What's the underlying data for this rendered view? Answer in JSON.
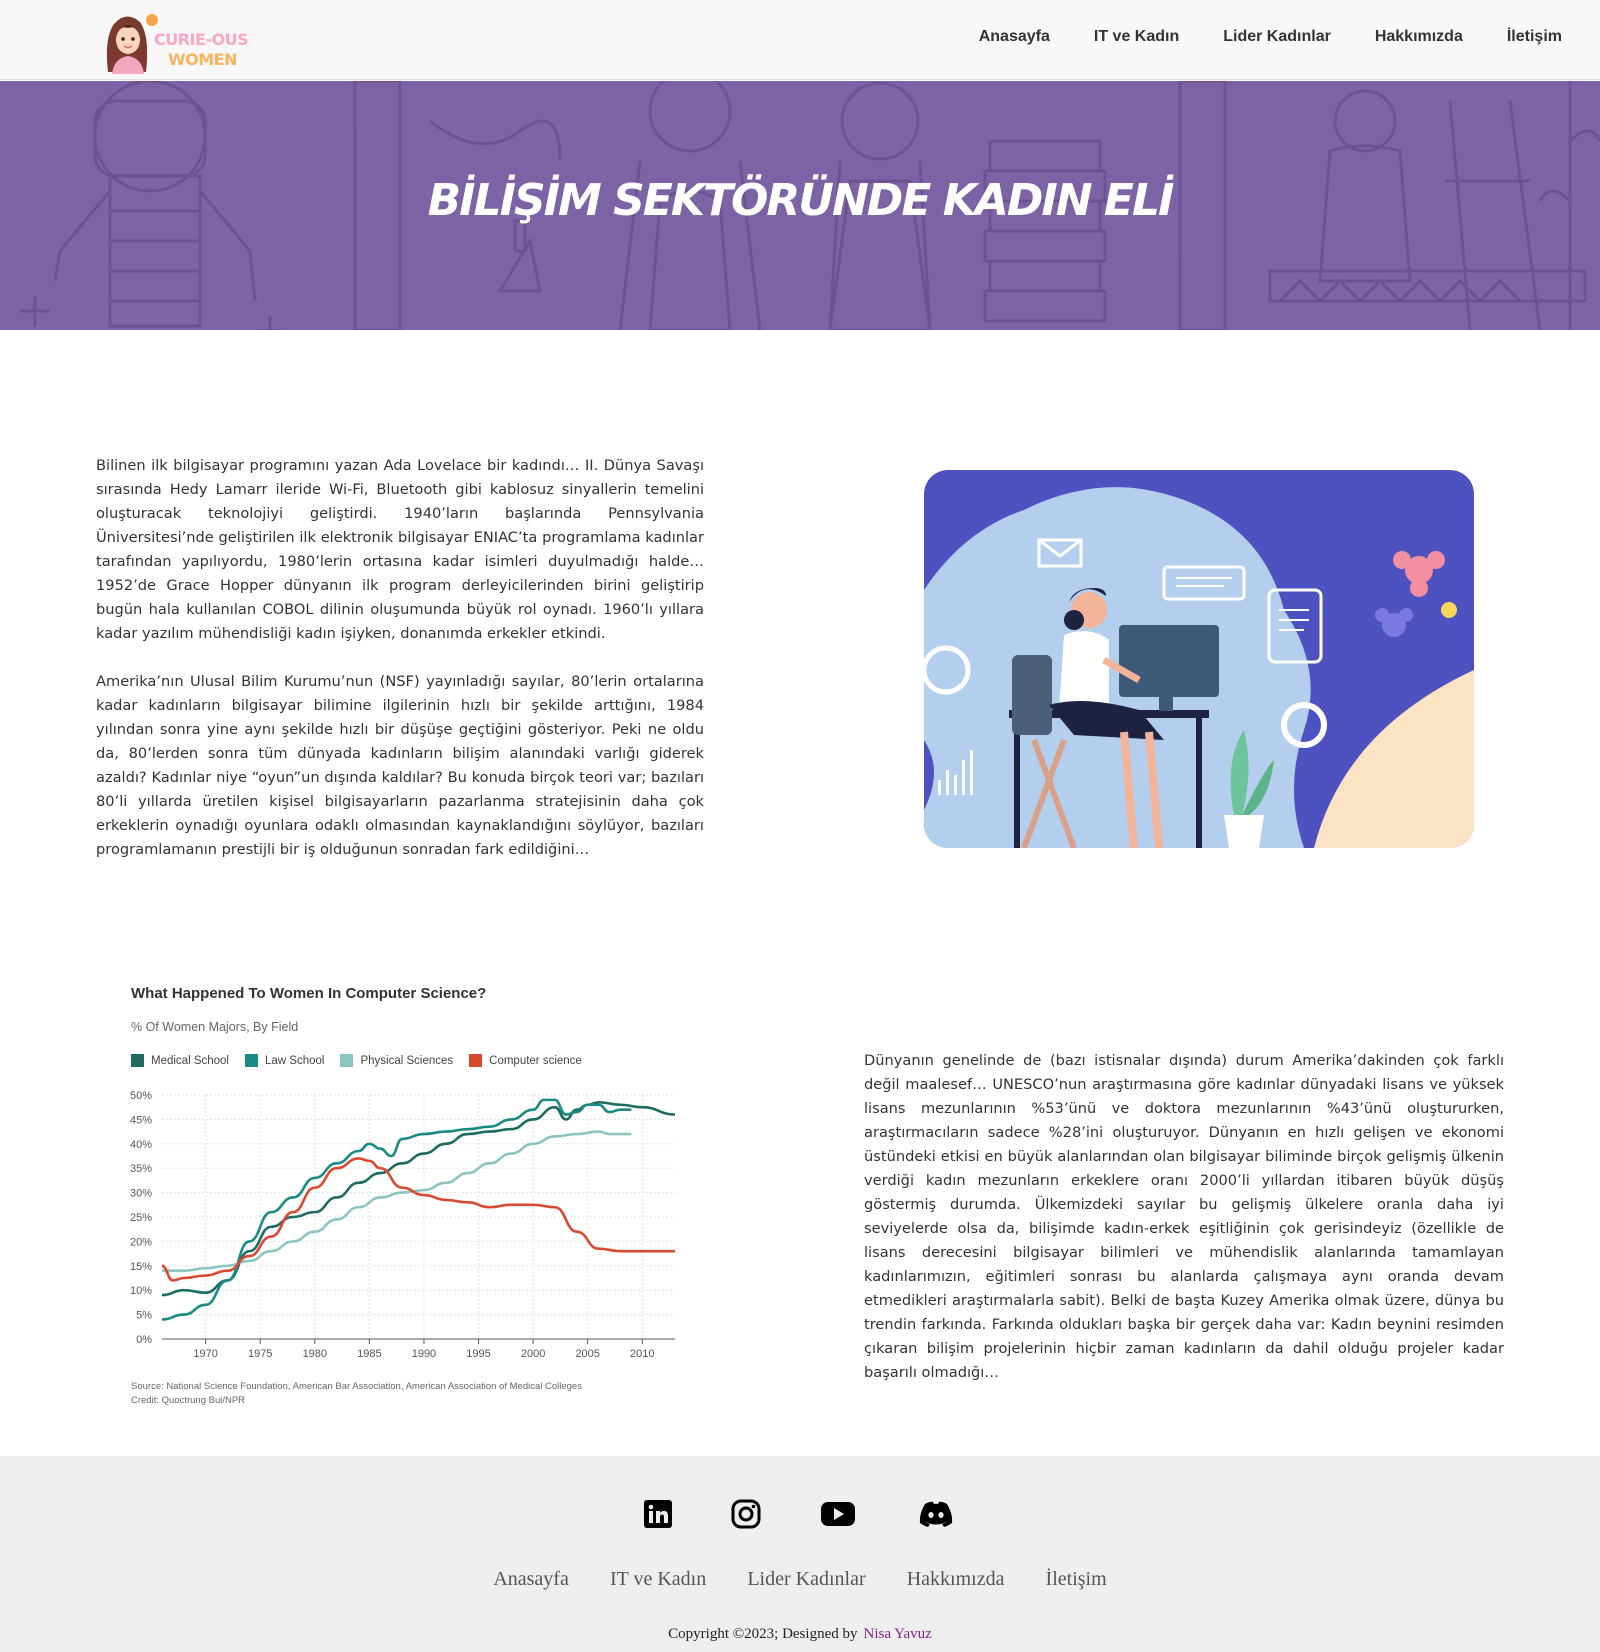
{
  "nav": {
    "logo_line1": "CURIE-OUS",
    "logo_line2": "WOMEN",
    "links": [
      "Anasayfa",
      "IT ve Kadın",
      "Lider Kadınlar",
      "Hakkımızda",
      "İletişim"
    ]
  },
  "hero": {
    "title": "BİLİŞİM SEKTÖRÜNDE KADIN ELİ",
    "bg_color": "#7c63a6"
  },
  "content": {
    "paragraph1": "Bilinen ilk bilgisayar programını yazan Ada Lovelace bir kadındı… II. Dünya Savaşı sırasında Hedy Lamarr ileride Wi-Fi, Bluetooth gibi kablosuz sinyallerin temelini oluşturacak teknolojiyi geliştirdi. 1940’ların başlarında Pennsylvania Üniversitesi’nde geliştirilen ilk elektronik bilgisayar ENIAC’ta programlama kadınlar tarafından yapılıyordu, 1980’lerin ortasına kadar isimleri duyulmadığı halde… 1952’de Grace Hopper dünyanın ilk program derleyicilerinden birini geliştirip bugün hala kullanılan COBOL dilinin oluşumunda büyük rol oynadı. 1960’lı yıllara kadar yazılım mühendisliği kadın işiyken, donanımda erkekler etkindi.",
    "paragraph2": "Amerika’nın Ulusal Bilim Kurumu’nun (NSF) yayınladığı sayılar, 80’lerin ortalarına kadar kadınların bilgisayar bilimine ilgilerinin hızlı bir şekilde arttığını, 1984 yılından sonra yine aynı şekilde hızlı bir düşüşe geçtiğini gösteriyor. Peki ne oldu da, 80’lerden sonra tüm dünyada kadınların bilişim alanındaki varlığı giderek azaldı? Kadınlar niye “oyun”un dışında kaldılar? Bu konuda birçok teori var; bazıları 80’li yıllarda üretilen kişisel bilgisayarların pazarlanma stratejisinin daha çok erkeklerin oynadığı oyunlara odaklı olmasından kaynaklandığını söylüyor, bazıları programlamanın prestijli bir iş olduğunun sonradan fark edildiğini…",
    "paragraph3": "Dünyanın genelinde de (bazı istisnalar dışında) durum Amerika’dakinden çok farklı değil maalesef… UNESCO’nun araştırmasına göre kadınlar dünyadaki lisans ve yüksek lisans mezunlarının %53’ünü ve doktora mezunlarının %43’ünü oluştururken, araştırmacıların sadece %28’ini oluşturuyor. Dünyanın en hızlı gelişen ve ekonomi üstündeki etkisi en büyük alanlarından olan bilgisayar biliminde birçok gelişmiş ülkenin verdiği kadın mezunların erkeklere oranı 2000’li yıllardan itibaren büyük düşüş göstermiş durumda. Ülkemizdeki sayılar bu gelişmiş ülkelere oranla daha iyi seviyelerde olsa da, bilişimde kadın-erkek eşitliğinin çok gerisindeyiz (özellikle de lisans derecesini bilgisayar bilimleri ve mühendislik alanlarında tamamlayan kadınlarımızın, eğitimleri sonrası bu alanlarda çalışmaya aynı oranda devam etmedikleri araştırmalarla sabit). Belki de başta Kuzey Amerika olmak üzere, dünya bu trendin farkında. Farkında oldukları başka bir gerçek daha var: Kadın beynini resimden çıkaran bilişim projelerinin hiçbir zaman kadınların da dahil olduğu projeler kadar başarılı olmadığı…"
  },
  "chart_data": {
    "type": "line",
    "title": "What Happened To Women In Computer Science?",
    "subtitle": "% Of Women Majors, By Field",
    "source_line1": "Source: National Science Foundation, American Bar Association, American Association of Medical Colleges",
    "source_line2": "Credit: Quoctrung Bui/NPR",
    "xlim": [
      1966,
      2013
    ],
    "ylim": [
      0,
      50
    ],
    "x_ticks": [
      1970,
      1975,
      1980,
      1985,
      1990,
      1995,
      2000,
      2005,
      2010
    ],
    "y_ticks": [
      0,
      5,
      10,
      15,
      20,
      25,
      30,
      35,
      40,
      45,
      50
    ],
    "y_tick_labels": [
      "0%",
      "5%",
      "10%",
      "15%",
      "20%",
      "25%",
      "30%",
      "35%",
      "40%",
      "45%",
      "50%"
    ],
    "grid": true,
    "legend": "top-left",
    "series": [
      {
        "name": "Medical School",
        "color": "#1e6b62",
        "points": [
          [
            1966,
            9
          ],
          [
            1968,
            10
          ],
          [
            1970,
            9.5
          ],
          [
            1972,
            12
          ],
          [
            1974,
            18
          ],
          [
            1976,
            23
          ],
          [
            1978,
            25
          ],
          [
            1980,
            26
          ],
          [
            1982,
            29
          ],
          [
            1984,
            32
          ],
          [
            1986,
            34
          ],
          [
            1988,
            36
          ],
          [
            1990,
            38
          ],
          [
            1992,
            40
          ],
          [
            1994,
            42
          ],
          [
            1996,
            42.5
          ],
          [
            1998,
            43
          ],
          [
            2000,
            45
          ],
          [
            2002,
            47.5
          ],
          [
            2003,
            45
          ],
          [
            2004,
            47
          ],
          [
            2005,
            48
          ],
          [
            2006,
            48.5
          ],
          [
            2008,
            48
          ],
          [
            2010,
            47.5
          ],
          [
            2013,
            46
          ]
        ]
      },
      {
        "name": "Law School",
        "color": "#1a8a84",
        "points": [
          [
            1966,
            4
          ],
          [
            1968,
            5
          ],
          [
            1970,
            7
          ],
          [
            1972,
            12
          ],
          [
            1974,
            20
          ],
          [
            1976,
            26
          ],
          [
            1978,
            29
          ],
          [
            1980,
            33
          ],
          [
            1982,
            36
          ],
          [
            1984,
            38.5
          ],
          [
            1985,
            40
          ],
          [
            1986,
            39
          ],
          [
            1987,
            37.5
          ],
          [
            1988,
            41
          ],
          [
            1990,
            42
          ],
          [
            1992,
            42.5
          ],
          [
            1994,
            43
          ],
          [
            1996,
            43.5
          ],
          [
            1998,
            45
          ],
          [
            2000,
            47
          ],
          [
            2001,
            49
          ],
          [
            2002,
            49
          ],
          [
            2003,
            46
          ],
          [
            2004,
            46.5
          ],
          [
            2005,
            48
          ],
          [
            2006,
            48
          ],
          [
            2007,
            46.5
          ],
          [
            2008,
            47
          ],
          [
            2009,
            47
          ]
        ]
      },
      {
        "name": "Physical Sciences",
        "color": "#8cc4c2",
        "points": [
          [
            1966,
            14
          ],
          [
            1968,
            14
          ],
          [
            1970,
            14.5
          ],
          [
            1972,
            15
          ],
          [
            1974,
            16
          ],
          [
            1976,
            18
          ],
          [
            1978,
            20
          ],
          [
            1980,
            22
          ],
          [
            1982,
            24.5
          ],
          [
            1984,
            27
          ],
          [
            1986,
            29
          ],
          [
            1988,
            30
          ],
          [
            1990,
            30.5
          ],
          [
            1992,
            32
          ],
          [
            1994,
            34
          ],
          [
            1996,
            36
          ],
          [
            1998,
            38
          ],
          [
            2000,
            40
          ],
          [
            2002,
            41.5
          ],
          [
            2004,
            42
          ],
          [
            2006,
            42.5
          ],
          [
            2007,
            42
          ],
          [
            2008,
            42
          ],
          [
            2009,
            42
          ]
        ]
      },
      {
        "name": "Computer science",
        "color": "#d9492f",
        "points": [
          [
            1966,
            15
          ],
          [
            1967,
            12
          ],
          [
            1968,
            12.5
          ],
          [
            1970,
            13
          ],
          [
            1972,
            14
          ],
          [
            1974,
            17
          ],
          [
            1976,
            21
          ],
          [
            1978,
            26
          ],
          [
            1980,
            31
          ],
          [
            1982,
            35
          ],
          [
            1984,
            37
          ],
          [
            1985,
            36.5
          ],
          [
            1986,
            35
          ],
          [
            1988,
            31
          ],
          [
            1990,
            29.5
          ],
          [
            1992,
            28.5
          ],
          [
            1994,
            28
          ],
          [
            1996,
            27
          ],
          [
            1998,
            27.5
          ],
          [
            2000,
            27.5
          ],
          [
            2002,
            27
          ],
          [
            2004,
            22
          ],
          [
            2006,
            18.5
          ],
          [
            2008,
            18
          ],
          [
            2010,
            18
          ],
          [
            2013,
            18
          ]
        ]
      }
    ]
  },
  "footer": {
    "social": [
      "linkedin-icon",
      "instagram-icon",
      "youtube-icon",
      "discord-icon"
    ],
    "links": [
      "Anasayfa",
      "IT ve Kadın",
      "Lider Kadınlar",
      "Hakkımızda",
      "İletişim"
    ],
    "copyright": "Copyright ©2023; Designed by",
    "author": "Nisa Yavuz"
  }
}
